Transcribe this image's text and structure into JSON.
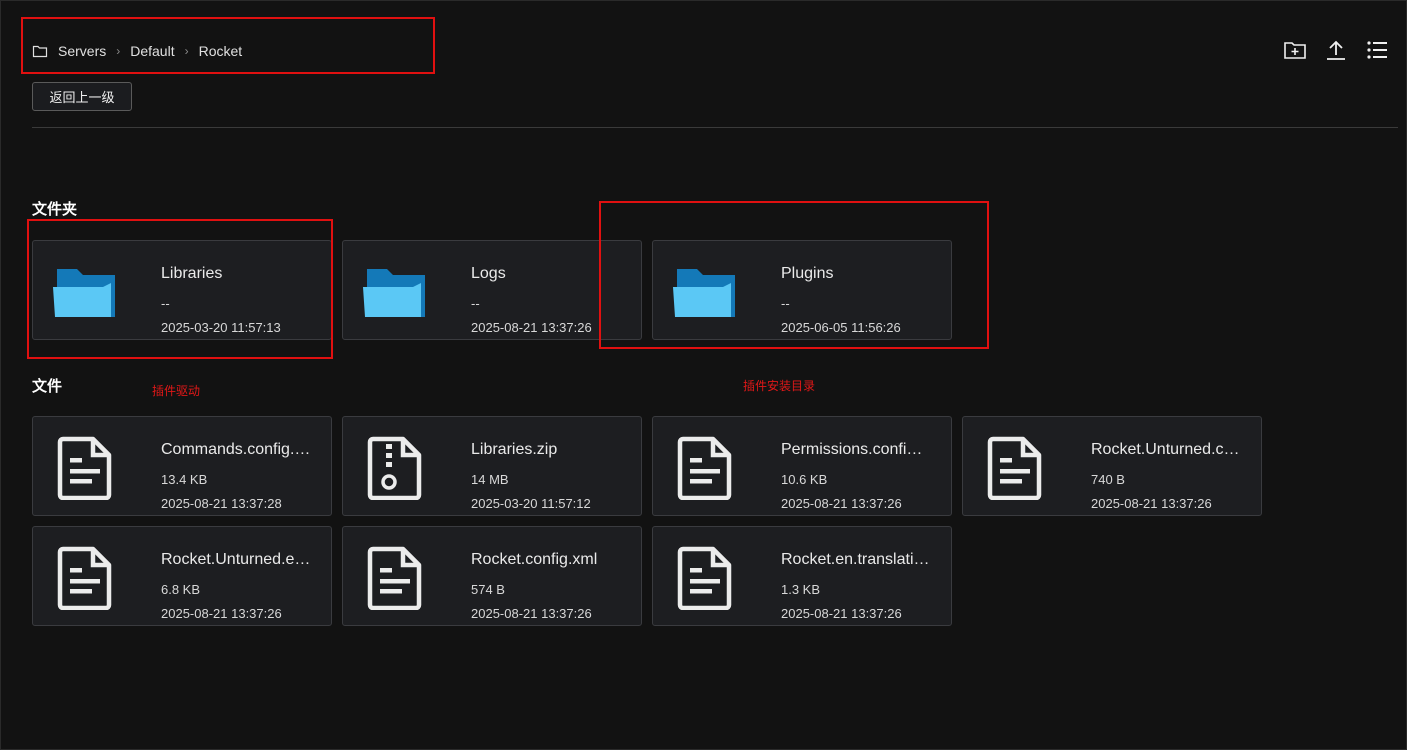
{
  "breadcrumb": {
    "icon": "folder-outline-icon",
    "items": [
      "Servers",
      "Default",
      "Rocket"
    ]
  },
  "back_button": "返回上一级",
  "toolbar": {
    "icons": [
      "new-folder-icon",
      "upload-icon",
      "list-view-icon"
    ]
  },
  "sections": {
    "folders_title": "文件夹",
    "files_title": "文件"
  },
  "folders": [
    {
      "name": "Libraries",
      "size": "--",
      "date": "2025-03-20 11:57:13"
    },
    {
      "name": "Logs",
      "size": "--",
      "date": "2025-08-21 13:37:26"
    },
    {
      "name": "Plugins",
      "size": "--",
      "date": "2025-06-05 11:56:26"
    }
  ],
  "files": [
    {
      "name": "Commands.config.xml",
      "size": "13.4 KB",
      "date": "2025-08-21 13:37:28",
      "icon": "document-icon"
    },
    {
      "name": "Libraries.zip",
      "size": "14 MB",
      "date": "2025-03-20 11:57:12",
      "icon": "zip-icon"
    },
    {
      "name": "Permissions.config.xml",
      "size": "10.6 KB",
      "date": "2025-08-21 13:37:26",
      "icon": "document-icon"
    },
    {
      "name": "Rocket.Unturned.config.xml",
      "size": "740 B",
      "date": "2025-08-21 13:37:26",
      "icon": "document-icon"
    },
    {
      "name": "Rocket.Unturned.en.translation.xml",
      "size": "6.8 KB",
      "date": "2025-08-21 13:37:26",
      "icon": "document-icon"
    },
    {
      "name": "Rocket.config.xml",
      "size": "574 B",
      "date": "2025-08-21 13:37:26",
      "icon": "document-icon"
    },
    {
      "name": "Rocket.en.translation.xml",
      "size": "1.3 KB",
      "date": "2025-08-21 13:37:26",
      "icon": "document-icon"
    }
  ],
  "annotations": {
    "libraries_note": "插件驱动",
    "plugins_note": "插件安装目录",
    "color": "#e01010"
  },
  "colors": {
    "background": "#121212",
    "card": "#1d1e21",
    "folder_light": "#5bc8f5",
    "folder_dark": "#1479b8"
  }
}
